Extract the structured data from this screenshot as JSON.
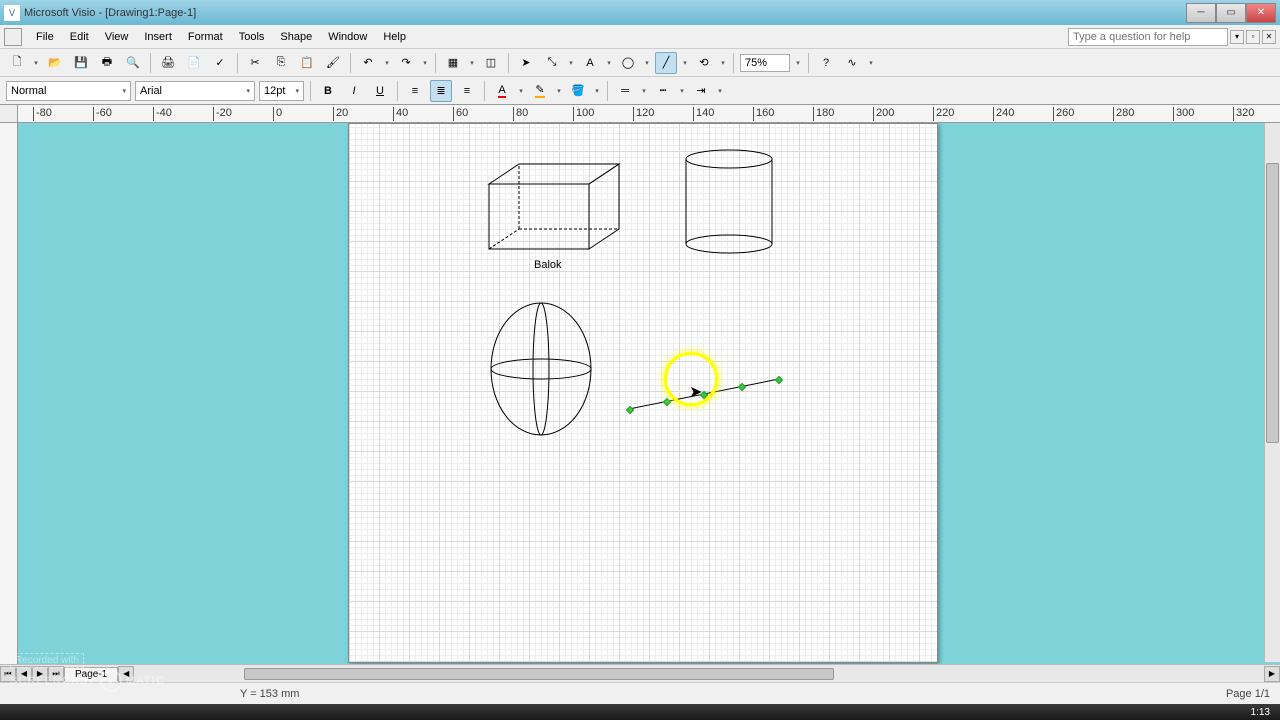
{
  "window": {
    "title": "Microsoft Visio - [Drawing1:Page-1]"
  },
  "menu": {
    "items": [
      "File",
      "Edit",
      "View",
      "Insert",
      "Format",
      "Tools",
      "Shape",
      "Window",
      "Help"
    ],
    "help_placeholder": "Type a question for help"
  },
  "toolbar": {
    "zoom": "75%"
  },
  "format": {
    "style": "Normal",
    "font": "Arial",
    "size": "12pt"
  },
  "ruler": {
    "h": [
      "-80",
      "-60",
      "-40",
      "-20",
      "0",
      "20",
      "40",
      "60",
      "80",
      "100",
      "120",
      "140",
      "160",
      "180",
      "200",
      "220",
      "240",
      "260",
      "280",
      "300",
      "320"
    ]
  },
  "shapes": {
    "box": {
      "label": "Balok"
    },
    "selected_line": {
      "handles": 5
    }
  },
  "highlight": {
    "present": true
  },
  "pagetab": {
    "label": "Page-1"
  },
  "status": {
    "coord": "Y = 153 mm",
    "page": "Page 1/1"
  },
  "watermark": {
    "line1": "Recorded with",
    "line2a": "SCREENCAST",
    "line2b": "MATIC"
  },
  "clock": {
    "time": "1:13"
  }
}
